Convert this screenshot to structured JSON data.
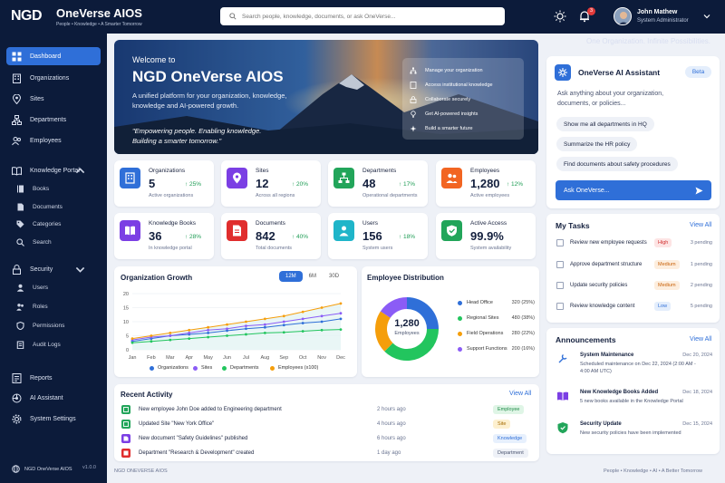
{
  "app": {
    "logo": "NGD",
    "title": "OneVerse AIOS",
    "tagline": "People • Knowledge • A Smarter Tomorrow"
  },
  "search": {
    "placeholder": "Search people, knowledge, documents, or ask OneVerse..."
  },
  "notifications": {
    "count": "3"
  },
  "user": {
    "name": "John Mathew",
    "role": "System Administrator"
  },
  "header_tagline": "One Organization. Infinite Possibilities.",
  "nav": {
    "dashboard": "Dashboard",
    "organizations": "Organizations",
    "sites": "Sites",
    "departments": "Departments",
    "employees": "Employees",
    "knowledge_portal": "Knowledge Portal",
    "books": "Books",
    "documents": "Documents",
    "categories": "Categories",
    "search": "Search",
    "security": "Security",
    "users": "Users",
    "roles": "Roles",
    "permissions": "Permissions",
    "audit_logs": "Audit Logs",
    "reports": "Reports",
    "ai_assistant": "AI Assistant",
    "system_settings": "System Settings"
  },
  "sidebar_footer": {
    "name": "NGD OneVerse AIOS",
    "version": "v1.0.0"
  },
  "hero": {
    "welcome": "Welcome to",
    "title": "NGD OneVerse AIOS",
    "description": "A unified platform for your organization, knowledge, knowledge and AI-powered growth.",
    "quote_line1": "\"Empowering people. Enabling knowledge.",
    "quote_line2": "Building a smarter tomorrow.\"",
    "list": [
      "Manage your organization",
      "Access institutional knowledge",
      "Collaborate securely",
      "Get AI-powered insights",
      "Build a smarter future"
    ]
  },
  "stats": [
    {
      "label": "Organizations",
      "value": "5",
      "change": "25%",
      "sub": "Active organizations",
      "color": "#2f6fd8",
      "icon": "building-icon"
    },
    {
      "label": "Sites",
      "value": "12",
      "change": "20%",
      "sub": "Across all regions",
      "color": "#7b3fe4",
      "icon": "pin-icon"
    },
    {
      "label": "Departments",
      "value": "48",
      "change": "17%",
      "sub": "Operational departments",
      "color": "#22a55a",
      "icon": "org-icon"
    },
    {
      "label": "Employees",
      "value": "1,280",
      "change": "12%",
      "sub": "Active employees",
      "color": "#f26522",
      "icon": "people-icon"
    },
    {
      "label": "Knowledge Books",
      "value": "36",
      "change": "28%",
      "sub": "In knowledge portal",
      "color": "#7b3fe4",
      "icon": "book-icon"
    },
    {
      "label": "Documents",
      "value": "842",
      "change": "40%",
      "sub": "Total documents",
      "color": "#e02d2d",
      "icon": "doc-icon"
    },
    {
      "label": "Users",
      "value": "156",
      "change": "18%",
      "sub": "System users",
      "color": "#1fb5c9",
      "icon": "users-icon"
    },
    {
      "label": "Active Access",
      "value": "99.9%",
      "change": "",
      "sub": "System availability",
      "color": "#22a55a",
      "icon": "shield-icon"
    }
  ],
  "growth": {
    "title": "Organization Growth",
    "ranges": [
      "12M",
      "6M",
      "30D"
    ]
  },
  "distribution": {
    "title": "Employee Distribution",
    "center_value": "1,280",
    "center_label": "Employees",
    "rows": [
      {
        "name": "Head Office",
        "value": "320 (25%)",
        "color": "#2f6fd8"
      },
      {
        "name": "Regional Sites",
        "value": "480 (38%)",
        "color": "#22c55e"
      },
      {
        "name": "Field Operations",
        "value": "280 (22%)",
        "color": "#f59e0b"
      },
      {
        "name": "Support Functions",
        "value": "200 (16%)",
        "color": "#8b5cf6"
      }
    ]
  },
  "chart_data": [
    {
      "type": "line",
      "title": "Organization Growth",
      "x": [
        "Jan",
        "Feb",
        "Mar",
        "Apr",
        "May",
        "Jun",
        "Jul",
        "Aug",
        "Sep",
        "Oct",
        "Nov",
        "Dec"
      ],
      "ylim": [
        0,
        20
      ],
      "yticks": [
        "0",
        "5",
        "10",
        "15",
        "20"
      ],
      "series": [
        {
          "name": "Organizations",
          "color": "#2f6fd8",
          "values": [
            3,
            4,
            5,
            5.5,
            6,
            6.8,
            7.5,
            8,
            8.8,
            9.5,
            10,
            11
          ]
        },
        {
          "name": "Sites",
          "color": "#8b5cf6",
          "values": [
            3.5,
            4.5,
            5,
            6,
            7,
            7.5,
            8.5,
            9,
            10,
            11,
            12,
            13
          ]
        },
        {
          "name": "Departments",
          "color": "#22c55e",
          "values": [
            2.5,
            3,
            3.5,
            4,
            4.5,
            5,
            5.5,
            6,
            6.2,
            6.6,
            7,
            7.2
          ]
        },
        {
          "name": "Employees (x100)",
          "color": "#f59e0b",
          "values": [
            4,
            5,
            6,
            7,
            8,
            9,
            10,
            11,
            12,
            13.5,
            15,
            16.5
          ]
        }
      ]
    },
    {
      "type": "pie",
      "title": "Employee Distribution",
      "categories": [
        "Head Office",
        "Regional Sites",
        "Field Operations",
        "Support Functions"
      ],
      "values": [
        320,
        480,
        280,
        200
      ]
    }
  ],
  "activity": {
    "title": "Recent Activity",
    "view_all": "View All",
    "rows": [
      {
        "text": "New employee John Doe added to Engineering department",
        "time": "2 hours ago",
        "tag": "Employee",
        "color": "#22a55a",
        "tag_bg": "#dff5e6",
        "tag_fg": "#1e8a47"
      },
      {
        "text": "Updated Site \"New York Office\"",
        "time": "4 hours ago",
        "tag": "Site",
        "color": "#22a55a",
        "tag_bg": "#fdf0cf",
        "tag_fg": "#a46a00"
      },
      {
        "text": "New document \"Safety Guidelines\" published",
        "time": "6 hours ago",
        "tag": "Knowledge",
        "color": "#7b3fe4",
        "tag_bg": "#e7f0fd",
        "tag_fg": "#2f6fd8"
      },
      {
        "text": "Department \"Research & Development\" created",
        "time": "1 day ago",
        "tag": "Department",
        "color": "#e02d2d",
        "tag_bg": "#eef1f7",
        "tag_fg": "#4a5470"
      }
    ]
  },
  "ai": {
    "title": "OneVerse AI Assistant",
    "badge": "Beta",
    "prompt": "Ask anything about your organization, documents, or policies...",
    "suggestions": [
      "Show me all departments in HQ",
      "Summarize the HR policy",
      "Find documents about safety procedures"
    ],
    "button": "Ask OneVerse..."
  },
  "tasks": {
    "title": "My Tasks",
    "view_all": "View All",
    "rows": [
      {
        "text": "Review new employee requests",
        "priority": "High",
        "pending": "3 pending",
        "bg": "#fde4e4",
        "fg": "#d12f2f"
      },
      {
        "text": "Approve department structure",
        "priority": "Medium",
        "pending": "1 pending",
        "bg": "#fdeede",
        "fg": "#c9620a"
      },
      {
        "text": "Update security policies",
        "priority": "Medium",
        "pending": "2 pending",
        "bg": "#fdeede",
        "fg": "#c9620a"
      },
      {
        "text": "Review knowledge content",
        "priority": "Low",
        "pending": "5 pending",
        "bg": "#e4eefc",
        "fg": "#2f6fd8"
      }
    ]
  },
  "announcements": {
    "title": "Announcements",
    "view_all": "View All",
    "rows": [
      {
        "title": "System Maintenance",
        "date": "Dec 20, 2024",
        "desc": "Scheduled maintenance on Dec 22, 2024 (2:00 AM - 4:00 AM UTC)",
        "color": "#2f6fd8",
        "icon": "wrench-icon"
      },
      {
        "title": "New Knowledge Books Added",
        "date": "Dec 18, 2024",
        "desc": "5 new books available in the Knowledge Portal",
        "color": "#7b3fe4",
        "icon": "book-icon"
      },
      {
        "title": "Security Update",
        "date": "Dec 15, 2024",
        "desc": "New security policies have been implemented",
        "color": "#22a55a",
        "icon": "shield-icon"
      }
    ]
  },
  "footer": {
    "left": "NGD ONEVERSE AIOS",
    "right": "People • Knowledge • AI • A Better Tomorrow"
  }
}
